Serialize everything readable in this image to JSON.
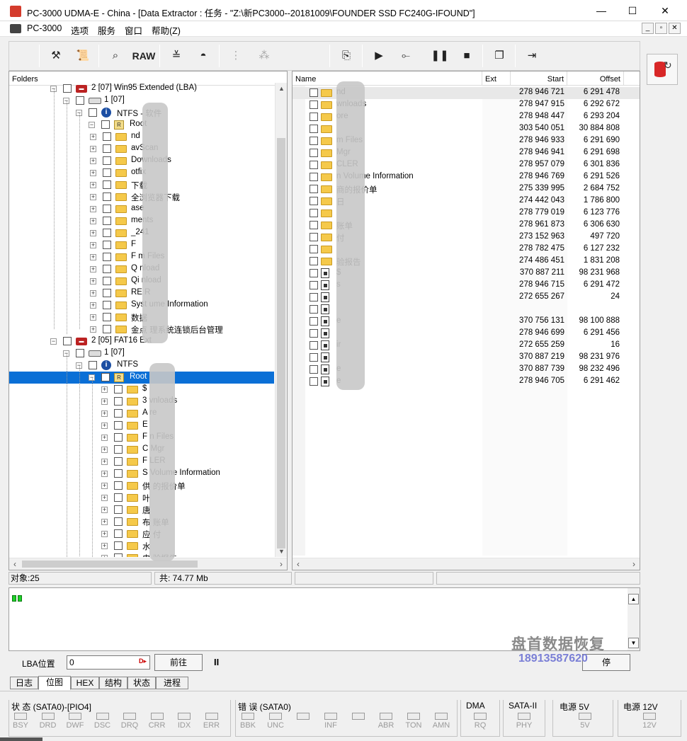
{
  "window": {
    "title": "PC-3000 UDMA-E - China - [Data Extractor : 任务 - \"Z:\\新PC3000--20181009\\FOUNDER SSD FC240G-IFOUND\"]",
    "controls": [
      "—",
      "☐",
      "✕"
    ]
  },
  "menu": {
    "items": [
      "PC-3000",
      "选项",
      "服务",
      "窗口",
      "帮助(Z)"
    ],
    "mdi_controls": [
      "_",
      "▫",
      "✕"
    ]
  },
  "toolbar": {
    "raw_label": "RAW"
  },
  "left_pane": {
    "header": "Folders",
    "rows": [
      {
        "label": "2 [07] Win95 Extended (LBA)",
        "icon": "part",
        "level": 0
      },
      {
        "label": "1 [07]",
        "icon": "disk",
        "level": 1
      },
      {
        "label": "NTFS - 软件",
        "icon": "info",
        "level": 2
      },
      {
        "label": "Root",
        "icon": "root",
        "level": 3
      },
      {
        "label": "nd",
        "icon": "folder",
        "level": 4
      },
      {
        "label": "avScan",
        "icon": "folder",
        "level": 4
      },
      {
        "label": "Downloads",
        "icon": "folder",
        "level": 4
      },
      {
        "label": "otfix",
        "icon": "folder",
        "level": 4
      },
      {
        "label": "下载",
        "icon": "folder",
        "level": 4
      },
      {
        "label": "全浏览器下载",
        "icon": "folder",
        "level": 4
      },
      {
        "label": "ase",
        "icon": "folder",
        "level": 4
      },
      {
        "label": "ments",
        "icon": "folder",
        "level": 4
      },
      {
        "label": "_241",
        "icon": "folder",
        "level": 4
      },
      {
        "label": "F",
        "icon": "folder",
        "level": 4
      },
      {
        "label": "F      m Files",
        "icon": "folder",
        "level": 4
      },
      {
        "label": "Q      nload",
        "icon": "folder",
        "level": 4
      },
      {
        "label": "Qi      nload",
        "icon": "folder",
        "level": 4
      },
      {
        "label": "RE       R",
        "icon": "folder",
        "level": 4
      },
      {
        "label": "Syst      ume Information",
        "icon": "folder",
        "level": 4
      },
      {
        "label": "数据",
        "icon": "folder",
        "level": 4
      },
      {
        "label": "金点      理系统连锁后台管理",
        "icon": "folder",
        "level": 4
      },
      {
        "label": "2 [05] FAT16 Ext",
        "icon": "part",
        "level": 0
      },
      {
        "label": "1 [07]",
        "icon": "disk",
        "level": 1
      },
      {
        "label": "NTFS",
        "icon": "info",
        "level": 2
      },
      {
        "label": "Root",
        "icon": "root",
        "level": 3
      },
      {
        "label": "$",
        "icon": "folder",
        "level": 4
      },
      {
        "label": "3      vnloads",
        "icon": "folder",
        "level": 4
      },
      {
        "label": "A      re",
        "icon": "folder",
        "level": 4
      },
      {
        "label": "E",
        "icon": "folder",
        "level": 4
      },
      {
        "label": "F      n Files",
        "icon": "folder",
        "level": 4
      },
      {
        "label": "C      Mgr",
        "icon": "folder",
        "level": 4
      },
      {
        "label": "F      LER",
        "icon": "folder",
        "level": 4
      },
      {
        "label": "S      Volume Information",
        "icon": "folder",
        "level": 4
      },
      {
        "label": "供      的报价单",
        "icon": "folder",
        "level": 4
      },
      {
        "label": "叶",
        "icon": "folder",
        "level": 4
      },
      {
        "label": "唐",
        "icon": "folder",
        "level": 4
      },
      {
        "label": "布      账单",
        "icon": "folder",
        "level": 4
      },
      {
        "label": "应      付",
        "icon": "folder",
        "level": 4
      },
      {
        "label": "水",
        "icon": "folder",
        "level": 4
      },
      {
        "label": "电      验报告",
        "icon": "folder",
        "level": 4
      }
    ]
  },
  "right_pane": {
    "columns": [
      "Name",
      "Ext",
      "Start",
      "Offset"
    ],
    "rows": [
      {
        "name": "nd",
        "ext": "",
        "start": "278 946 721",
        "offset": "6 291 478",
        "icon": "folder"
      },
      {
        "name": "wnloads",
        "ext": "",
        "start": "278 947 915",
        "offset": "6 292 672",
        "icon": "folder"
      },
      {
        "name": "ore",
        "ext": "",
        "start": "278 948 447",
        "offset": "6 293 204",
        "icon": "folder"
      },
      {
        "name": "",
        "ext": "",
        "start": "303 540 051",
        "offset": "30 884 808",
        "icon": "folder"
      },
      {
        "name": "m Files",
        "ext": "",
        "start": "278 946 933",
        "offset": "6 291 690",
        "icon": "folder"
      },
      {
        "name": "Mgr",
        "ext": "",
        "start": "278 946 941",
        "offset": "6 291 698",
        "icon": "folder"
      },
      {
        "name": "CLER",
        "ext": "",
        "start": "278 957 079",
        "offset": "6 301 836",
        "icon": "folder"
      },
      {
        "name": "n Volume Information",
        "ext": "",
        "start": "278 946 769",
        "offset": "6 291 526",
        "icon": "folder"
      },
      {
        "name": "商的报价单",
        "ext": "",
        "start": "275 339 995",
        "offset": "2 684 752",
        "icon": "folder"
      },
      {
        "name": "日",
        "ext": "",
        "start": "274 442 043",
        "offset": "1 786 800",
        "icon": "folder"
      },
      {
        "name": "",
        "ext": "",
        "start": "278 779 019",
        "offset": "6 123 776",
        "icon": "folder"
      },
      {
        "name": "账单",
        "ext": "",
        "start": "278 961 873",
        "offset": "6 306 630",
        "icon": "folder"
      },
      {
        "name": "付",
        "ext": "",
        "start": "273 152 963",
        "offset": "497 720",
        "icon": "folder"
      },
      {
        "name": "",
        "ext": "",
        "start": "278 782 475",
        "offset": "6 127 232",
        "icon": "folder"
      },
      {
        "name": "验报告",
        "ext": "",
        "start": "274 486 451",
        "offset": "1 831 208",
        "icon": "folder"
      },
      {
        "name": "$",
        "ext": "",
        "start": "370 887 211",
        "offset": "98 231 968",
        "icon": "file"
      },
      {
        "name": "s",
        "ext": "",
        "start": "278 946 715",
        "offset": "6 291 472",
        "icon": "file"
      },
      {
        "name": "",
        "ext": "",
        "start": "272 655 267",
        "offset": "24",
        "icon": "file"
      },
      {
        "name": "",
        "ext": "",
        "start": "",
        "offset": "",
        "icon": "file"
      },
      {
        "name": "e",
        "ext": "",
        "start": "370 756 131",
        "offset": "98 100 888",
        "icon": "file"
      },
      {
        "name": "",
        "ext": "",
        "start": "278 946 699",
        "offset": "6 291 456",
        "icon": "file"
      },
      {
        "name": "ir",
        "ext": "",
        "start": "272 655 259",
        "offset": "16",
        "icon": "file"
      },
      {
        "name": "",
        "ext": "",
        "start": "370 887 219",
        "offset": "98 231 976",
        "icon": "file"
      },
      {
        "name": "e",
        "ext": "",
        "start": "370 887 739",
        "offset": "98 232 496",
        "icon": "file"
      },
      {
        "name": "e",
        "ext": "",
        "start": "278 946 705",
        "offset": "6 291 462",
        "icon": "file"
      }
    ]
  },
  "status": {
    "objects": "对象:25",
    "total": "共: 74.77 Mb"
  },
  "lba": {
    "label": "LBA位置",
    "value": "0",
    "forward_label": "前往",
    "pause_label": "II",
    "other_label": "停"
  },
  "watermark": {
    "line1": "盘首数据恢复",
    "line2": "18913587620"
  },
  "tabs": [
    "日志",
    "位图",
    "HEX",
    "结构",
    "状态",
    "进程"
  ],
  "registers": {
    "status_title": "状 态 (SATA0)-[PIO4]",
    "status_regs": [
      "BSY",
      "DRD",
      "DWF",
      "DSC",
      "DRQ",
      "CRR",
      "IDX",
      "ERR"
    ],
    "error_title": "错 误 (SATA0)",
    "error_regs": [
      "BBK",
      "UNC",
      "",
      "INF",
      "",
      "ABR",
      "TON",
      "AMN"
    ],
    "dma_title": "DMA",
    "dma_regs": [
      "RQ"
    ],
    "sata_title": "SATA-II",
    "sata_regs": [
      "PHY"
    ],
    "p5_title": "电源 5V",
    "p5_regs": [
      "5V"
    ],
    "p12_title": "电源 12V",
    "p12_regs": [
      "12V"
    ]
  }
}
